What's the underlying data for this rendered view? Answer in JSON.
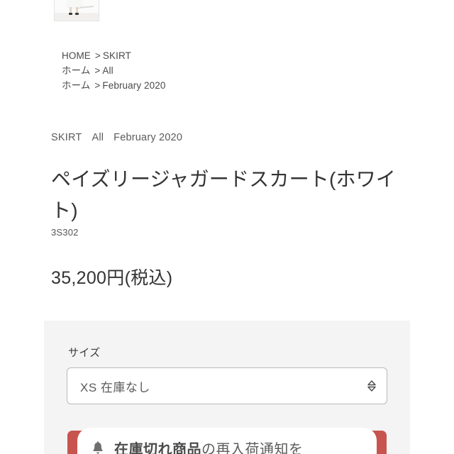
{
  "thumbnail": {
    "alt": "product-thumbnail-skirt-hem"
  },
  "breadcrumbs": [
    {
      "root": "HOME",
      "sep": ">",
      "leaf": "SKIRT"
    },
    {
      "root": "ホーム",
      "sep": ">",
      "leaf": "All"
    },
    {
      "root": "ホーム",
      "sep": ">",
      "leaf": "February 2020"
    }
  ],
  "categories": [
    "SKIRT",
    "All",
    "February 2020"
  ],
  "product": {
    "title": "ペイズリージャガードスカート(ホワイト)",
    "sku": "3S302",
    "price": "35,200円(税込)"
  },
  "options": {
    "size_label": "サイズ",
    "size_selected": "XS  在庫なし",
    "size_choices": [
      "XS  在庫なし"
    ],
    "chevron_icon": "chevron-up-down-icon"
  },
  "notify": {
    "bell_icon": "bell-icon",
    "text_bold": "在庫切れ商品",
    "text_rest": "の再入荷通知を",
    "accent_color": "#c8544f"
  },
  "colors": {
    "page_background": "#ffffff",
    "panel_background": "#f4f4f4",
    "text": "#333333",
    "muted_text": "#5b5b5b",
    "border": "#b9b9b9",
    "accent_red": "#c8544f"
  }
}
